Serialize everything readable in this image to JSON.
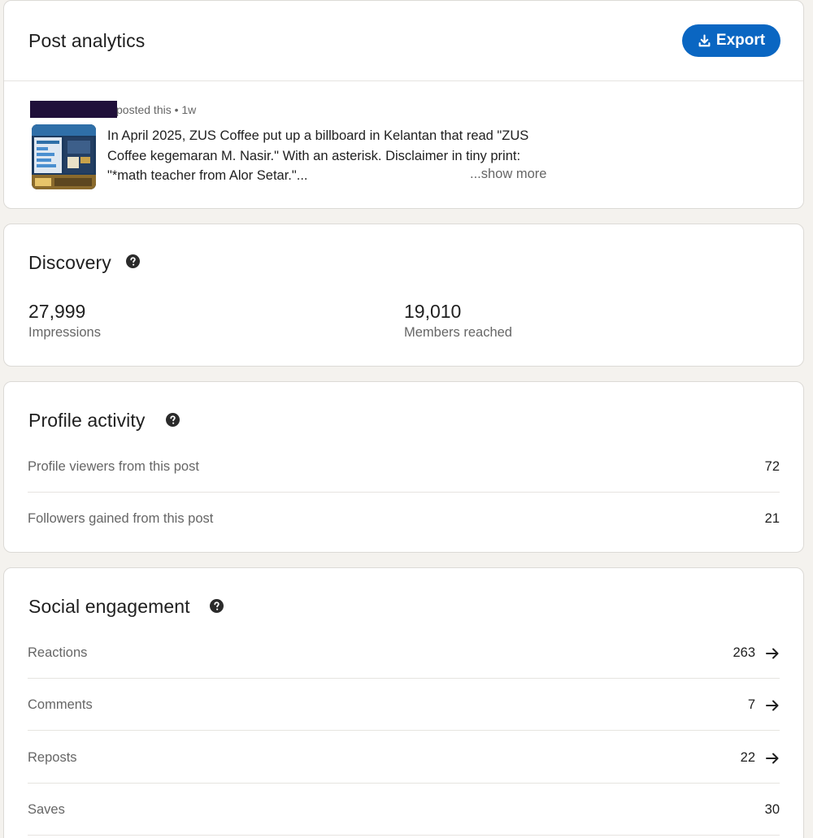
{
  "post_card": {
    "title": "Post analytics",
    "export_label": "Export",
    "posted_meta": "posted this • 1w",
    "post_text": "In April 2025, ZUS Coffee put up a billboard in Kelantan that read \"ZUS Coffee kegemaran M. Nasir.\" With an asterisk. Disclaimer in tiny print: \"*math teacher from Alor Setar.\"...",
    "show_more": "...show more",
    "thumbnail_icon": "post-thumbnail-image"
  },
  "discovery": {
    "title": "Discovery",
    "metrics": [
      {
        "value": "27,999",
        "label": "Impressions"
      },
      {
        "value": "19,010",
        "label": "Members reached"
      }
    ]
  },
  "profile_activity": {
    "title": "Profile activity",
    "rows": [
      {
        "label": "Profile viewers from this post",
        "value": "72"
      },
      {
        "label": "Followers gained from this post",
        "value": "21"
      }
    ]
  },
  "social_engagement": {
    "title": "Social engagement",
    "rows": [
      {
        "label": "Reactions",
        "value": "263"
      },
      {
        "label": "Comments",
        "value": "7"
      },
      {
        "label": "Reposts",
        "value": "22"
      },
      {
        "label": "Saves",
        "value": "30"
      }
    ]
  },
  "colors": {
    "accent": "#0a66c2",
    "background": "#f4f2ee",
    "card": "#ffffff",
    "muted_text": "#666666"
  }
}
